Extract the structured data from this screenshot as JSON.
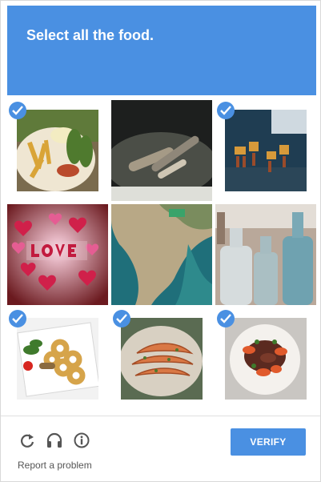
{
  "header": {
    "prompt_prefix": "Select all the ",
    "prompt_keyword": "food",
    "prompt_suffix": "."
  },
  "tiles": [
    {
      "name": "tile-fries-plate",
      "selected": true,
      "icon": "food-photo"
    },
    {
      "name": "tile-pens-dark",
      "selected": false,
      "icon": "photo"
    },
    {
      "name": "tile-mini-sculptures",
      "selected": true,
      "icon": "photo"
    },
    {
      "name": "tile-love-hearts",
      "selected": false,
      "icon": "photo"
    },
    {
      "name": "tile-coast-aerial",
      "selected": false,
      "icon": "photo"
    },
    {
      "name": "tile-glass-bottles",
      "selected": false,
      "icon": "photo"
    },
    {
      "name": "tile-calamari-plate",
      "selected": true,
      "icon": "food-photo"
    },
    {
      "name": "tile-shrimp-plate",
      "selected": true,
      "icon": "food-photo"
    },
    {
      "name": "tile-dish-plate",
      "selected": true,
      "icon": "food-photo"
    }
  ],
  "footer": {
    "verify_label": "VERIFY",
    "report_label": "Report a problem",
    "icons": [
      "reload-icon",
      "headphones-icon",
      "info-icon"
    ]
  },
  "colors": {
    "accent": "#4a90e2",
    "prompt_text": "#ffffff",
    "check_badge": "#4a90e2"
  }
}
